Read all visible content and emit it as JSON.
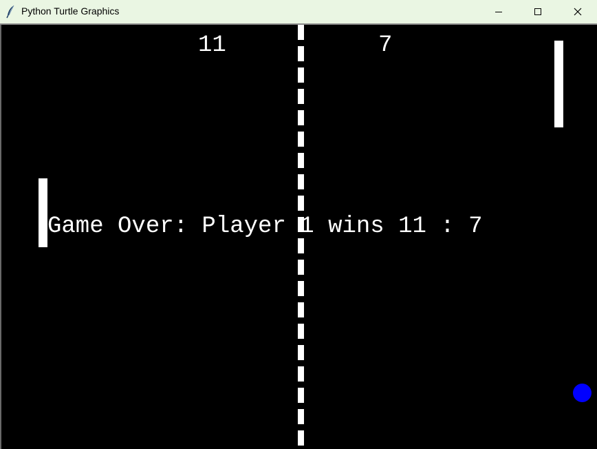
{
  "window": {
    "title": "Python Turtle Graphics",
    "icon": "feather-icon",
    "controls": [
      "minimize-icon",
      "maximize-icon",
      "close-icon"
    ]
  },
  "game": {
    "score_player1": "11",
    "score_player2": "7",
    "message": "Game Over: Player 1 wins 11 : 7",
    "colors": {
      "background": "#000000",
      "paddle": "#ffffff",
      "ball": "#0000ff",
      "text": "#ffffff",
      "center_line": "#ffffff"
    }
  }
}
